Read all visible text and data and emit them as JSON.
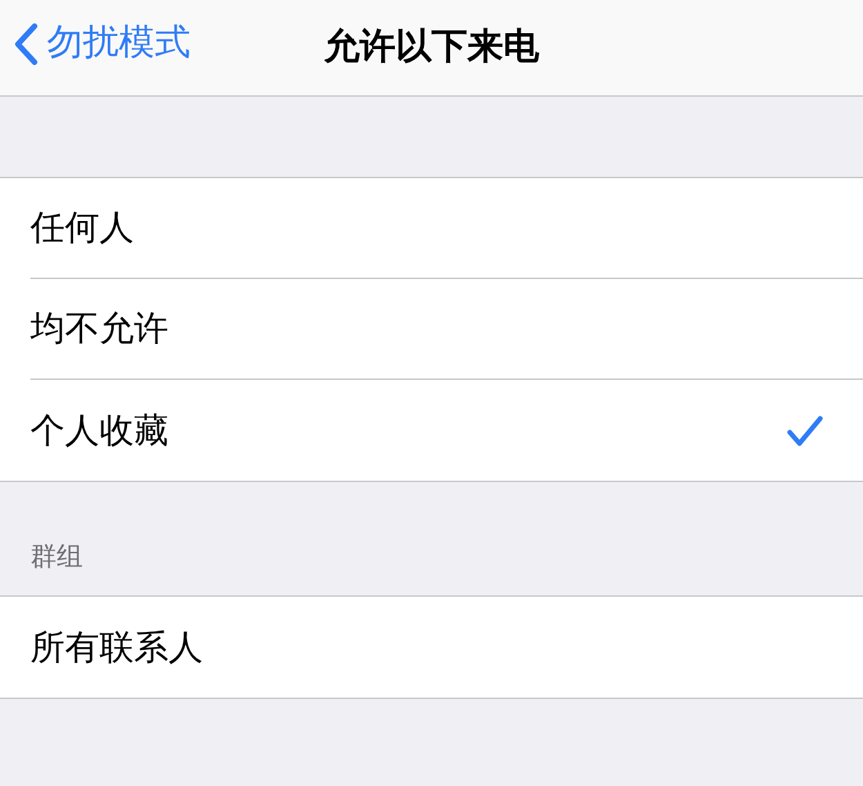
{
  "nav": {
    "back_label": "勿扰模式",
    "title": "允许以下来电"
  },
  "sections": [
    {
      "rows": [
        {
          "label": "任何人",
          "selected": false
        },
        {
          "label": "均不允许",
          "selected": false
        },
        {
          "label": "个人收藏",
          "selected": true
        }
      ]
    },
    {
      "header": "群组",
      "rows": [
        {
          "label": "所有联系人",
          "selected": false
        }
      ]
    }
  ]
}
